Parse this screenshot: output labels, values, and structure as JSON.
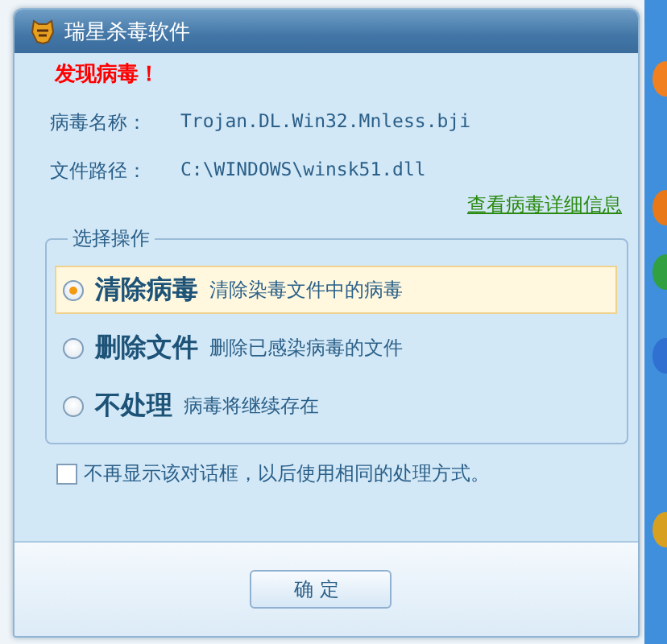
{
  "window": {
    "title": "瑞星杀毒软件"
  },
  "alert": "发现病毒！",
  "details": [
    {
      "label": "病毒名称：",
      "value": "Trojan.DL.Win32.Mnless.bji"
    },
    {
      "label": "文件路径：",
      "value": "C:\\WINDOWS\\winsk51.dll"
    }
  ],
  "detail_link": "查看病毒详细信息",
  "action_group": {
    "title": "选择操作",
    "options": [
      {
        "label": "清除病毒",
        "description": "清除染毒文件中的病毒",
        "selected": true
      },
      {
        "label": "删除文件",
        "description": "删除已感染病毒的文件",
        "selected": false
      },
      {
        "label": "不处理",
        "description": "病毒将继续存在",
        "selected": false
      }
    ]
  },
  "checkbox": {
    "label": "不再显示该对话框，以后使用相同的处理方式。",
    "checked": false
  },
  "buttons": [
    "确定"
  ]
}
